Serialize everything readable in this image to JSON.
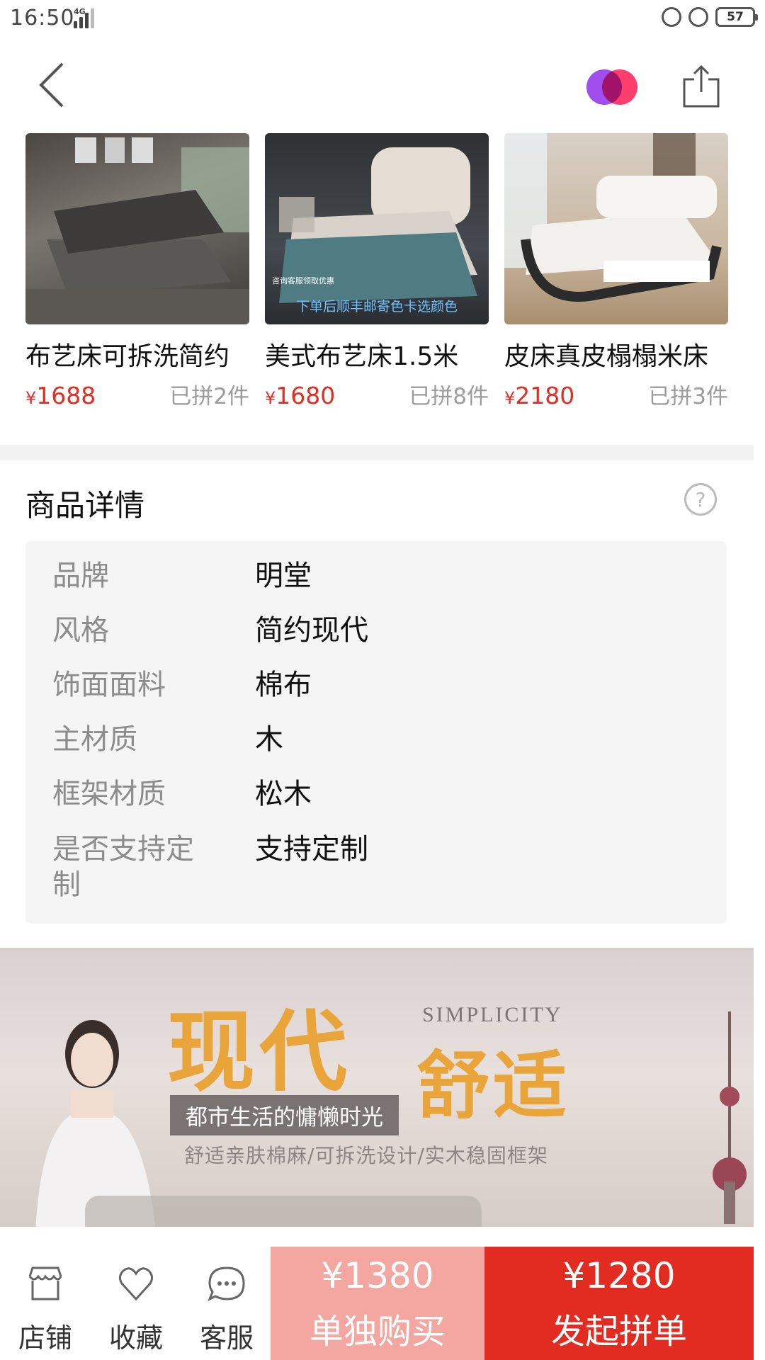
{
  "status_bar": {
    "time": "16:50",
    "network": "4G",
    "battery": "57"
  },
  "nav": {
    "back_icon": "chevron-left-icon",
    "profile_icon": "duo-circles-icon",
    "share_icon": "share-icon"
  },
  "related_products": [
    {
      "name": "布艺床可拆洗简约",
      "price": "1688",
      "currency": "¥",
      "sold": "已拼2件"
    },
    {
      "name": "美式布艺床1.5米",
      "price": "1680",
      "currency": "¥",
      "sold": "已拼8件",
      "image_caption_small": "咨询客服领取优惠",
      "image_caption": "下单后顺丰邮寄色卡选颜色"
    },
    {
      "name": "皮床真皮榻榻米床",
      "price": "2180",
      "currency": "¥",
      "sold": "已拼3件"
    }
  ],
  "details": {
    "title": "商品详情",
    "help": "?",
    "specs": [
      {
        "key": "品牌",
        "value": "明堂"
      },
      {
        "key": "风格",
        "value": "简约现代"
      },
      {
        "key": "饰面面料",
        "value": "棉布"
      },
      {
        "key": "主材质",
        "value": "木"
      },
      {
        "key": "框架材质",
        "value": "松木"
      },
      {
        "key": "是否支持定制",
        "value": "支持定制"
      }
    ]
  },
  "banner": {
    "title_part1": "现代",
    "title_part2": "舒适",
    "english": "SIMPLICITY",
    "tag": "都市生活的慵懒时光",
    "subtitle": "舒适亲肤棉麻/可拆洗设计/实木稳固框架"
  },
  "bottom_bar": {
    "store": "店铺",
    "favorite": "收藏",
    "service": "客服",
    "single_price": "¥1380",
    "single_label": "单独购买",
    "group_price": "¥1280",
    "group_label": "发起拼单"
  },
  "colors": {
    "accent": "#e22c21",
    "price": "#e02e24",
    "single_btn": "#f4a6a0",
    "banner_gold": "#e9a43a"
  }
}
